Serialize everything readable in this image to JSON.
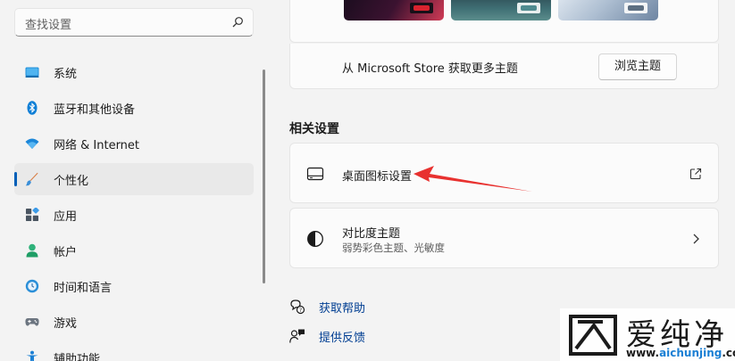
{
  "search": {
    "placeholder": "查找设置"
  },
  "nav": {
    "items": [
      {
        "label": "系统",
        "icon": "system-icon"
      },
      {
        "label": "蓝牙和其他设备",
        "icon": "bluetooth-icon"
      },
      {
        "label": "网络 & Internet",
        "icon": "wifi-icon"
      },
      {
        "label": "个性化",
        "icon": "brush-icon",
        "selected": true
      },
      {
        "label": "应用",
        "icon": "apps-icon"
      },
      {
        "label": "帐户",
        "icon": "account-icon"
      },
      {
        "label": "时间和语言",
        "icon": "clock-globe-icon"
      },
      {
        "label": "游戏",
        "icon": "gamepad-icon"
      },
      {
        "label": "辅助功能",
        "icon": "accessibility-icon"
      }
    ]
  },
  "themes": {
    "store_text": "从 Microsoft Store 获取更多主题",
    "browse_button": "浏览主题"
  },
  "related": {
    "title": "相关设置",
    "desktop_icons": {
      "title": "桌面图标设置"
    },
    "contrast": {
      "title": "对比度主题",
      "subtitle": "弱势彩色主题、光敏度"
    }
  },
  "help": {
    "get_help": "获取帮助",
    "feedback": "提供反馈"
  },
  "watermark": {
    "name": "爱纯净",
    "url_prefix": "www.",
    "url_brand": "aichunjing",
    "url_suffix": ".com"
  },
  "colors": {
    "accent": "#005fb8",
    "link": "#003e92",
    "arrow": "#e8312f"
  }
}
